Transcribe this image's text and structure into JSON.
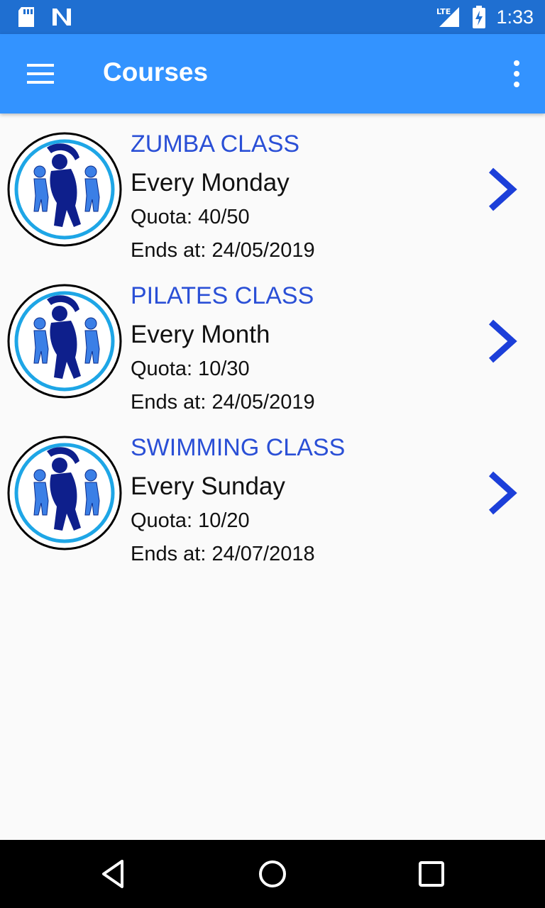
{
  "status_bar": {
    "time": "1:33",
    "network": "LTE",
    "icons": [
      "sd-card-icon",
      "n-notification-icon",
      "lte-signal-icon",
      "battery-charging-icon"
    ]
  },
  "app_bar": {
    "title": "Courses",
    "menu_icon": "hamburger-menu-icon",
    "overflow_icon": "more-vert-icon",
    "color": "#3393ff"
  },
  "courses": [
    {
      "title": "ZUMBA CLASS",
      "schedule": "Every Monday",
      "quota": "Quota: 40/50",
      "ends": "Ends at: 24/05/2019"
    },
    {
      "title": "PILATES CLASS",
      "schedule": "Every Month",
      "quota": "Quota: 10/30",
      "ends": "Ends at: 24/05/2019"
    },
    {
      "title": "SWIMMING CLASS",
      "schedule": "Every Sunday",
      "quota": "Quota: 10/20",
      "ends": "Ends at: 24/07/2018"
    }
  ],
  "colors": {
    "status_bar": "#1f6fd1",
    "course_title": "#2a4fd6",
    "chevron": "#1c3fd9"
  },
  "nav_bar": {
    "buttons": [
      "back-triangle-icon",
      "home-circle-icon",
      "recents-square-icon"
    ]
  }
}
